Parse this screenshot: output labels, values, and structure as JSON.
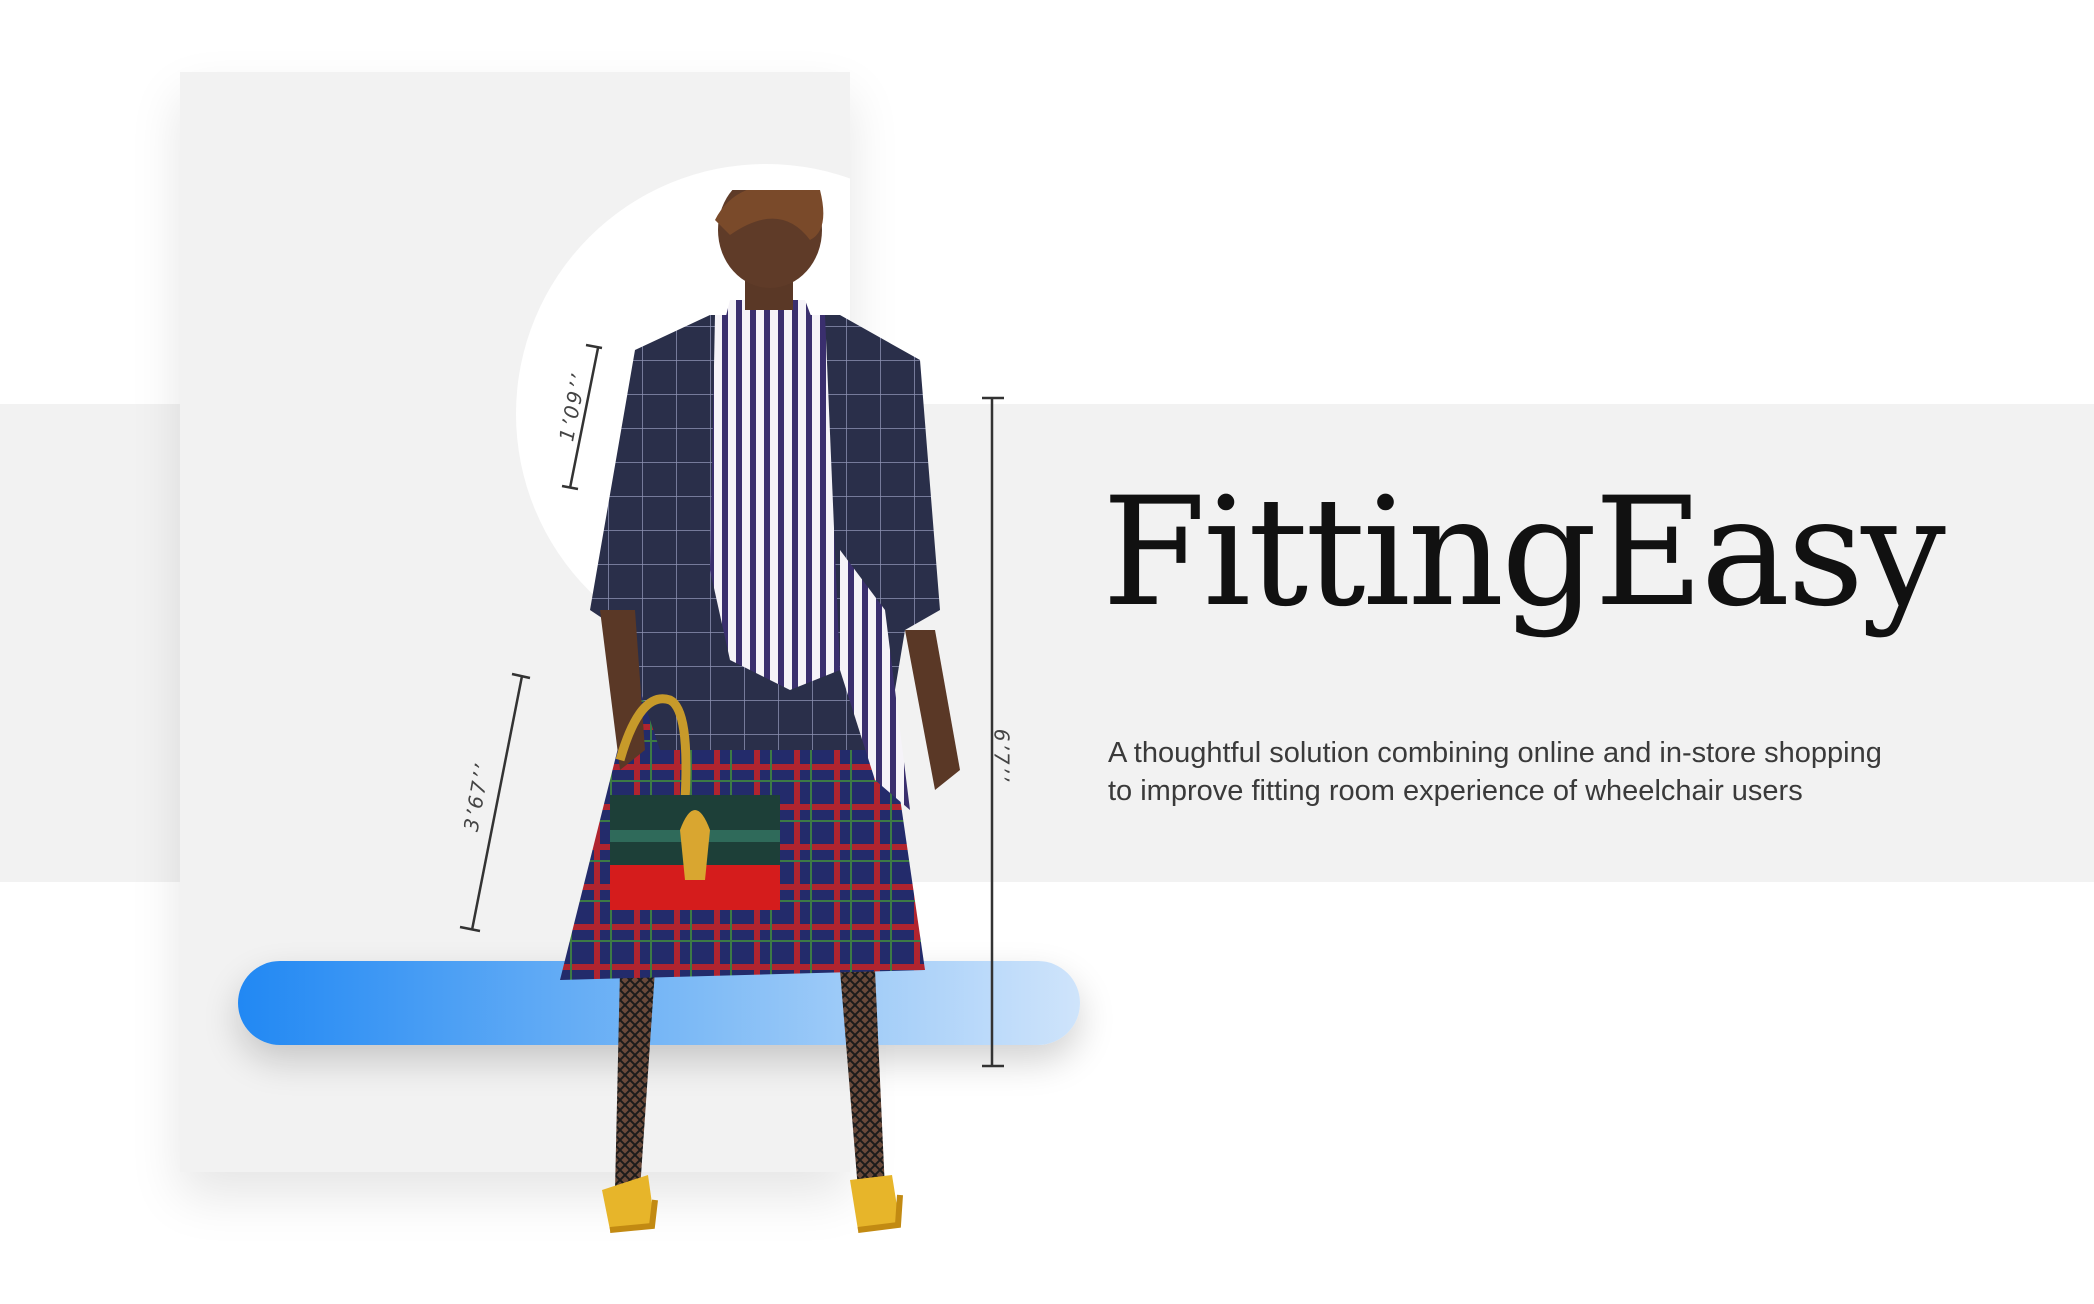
{
  "brand": {
    "title": "FittingEasy",
    "tagline_line1": "A thoughtful solution combining online and in-store shopping",
    "tagline_line2": "to improve fitting room experience of wheelchair users"
  },
  "measurements": {
    "head": "1’09’’",
    "leg": "3’67’’",
    "height": "6’7’’"
  },
  "colors": {
    "band": "#f2f2f2",
    "accent_gradient_start": "#2188f3",
    "accent_gradient_end": "#cfe4fb",
    "title_text": "#111111",
    "body_text": "#3a3a3a"
  }
}
